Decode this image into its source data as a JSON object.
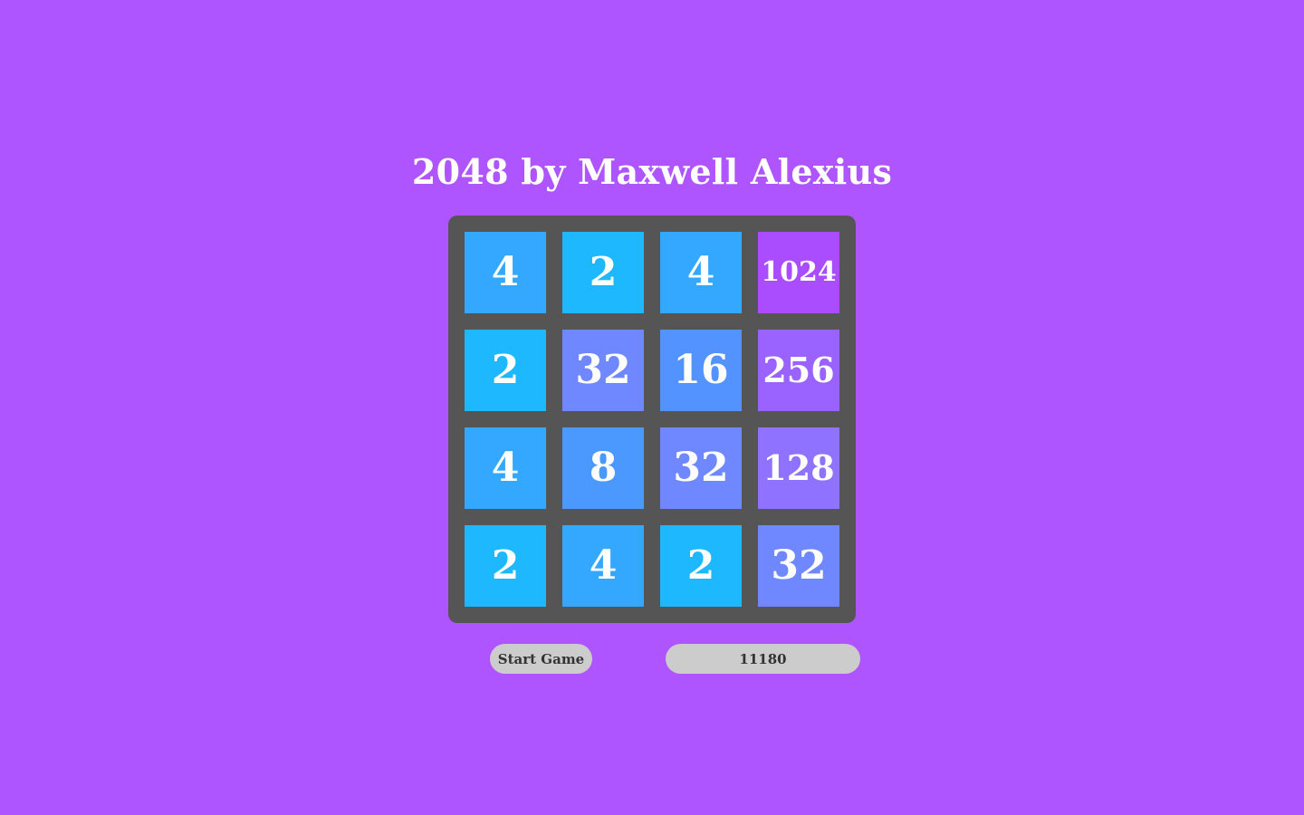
{
  "title": "2048 by Maxwell Alexius",
  "controls": {
    "start_label": "Start Game",
    "score": "11180"
  },
  "board": {
    "rows": [
      [
        4,
        2,
        4,
        1024
      ],
      [
        2,
        32,
        16,
        256
      ],
      [
        4,
        8,
        32,
        128
      ],
      [
        2,
        4,
        2,
        32
      ]
    ]
  },
  "colors": {
    "background": "#ae55ff",
    "board": "#555555",
    "text": "#ffffff",
    "button": "#cccccc",
    "tile_2": "#1db8ff",
    "tile_4": "#34a7ff",
    "tile_8": "#4b99ff",
    "tile_16": "#5293ff",
    "tile_32": "#7088ff",
    "tile_128": "#8f72ff",
    "tile_256": "#9a63ff",
    "tile_1024": "#aa4cff"
  }
}
